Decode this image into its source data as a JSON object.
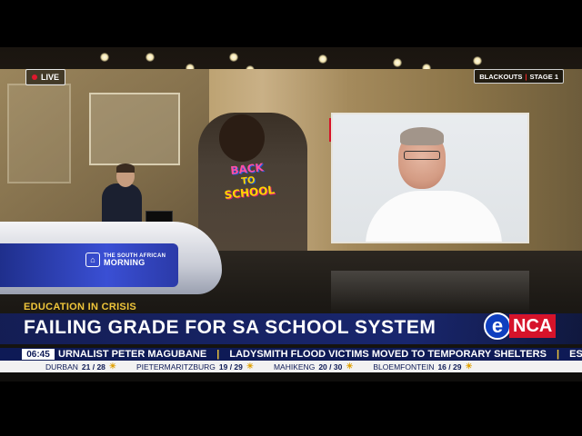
{
  "live_badge": "LIVE",
  "blackout_badge": {
    "label": "BLACKOUTS",
    "separator": "|",
    "stage": "STAGE 1"
  },
  "show_logo": {
    "line1": "THE SOUTH AFRICAN",
    "line2": "MORNING"
  },
  "shirt_text": {
    "line1": "BACK",
    "line2": "TO",
    "line3": "SCHOOL"
  },
  "lower_third": {
    "topic": "EDUCATION IN CRISIS",
    "headline": "FAILING GRADE FOR SA SCHOOL SYSTEM"
  },
  "channel_logo": {
    "e": "e",
    "nca": "NCA"
  },
  "ticker": {
    "time": "06:45",
    "items": [
      "URNALIST PETER MAGUBANE",
      "LADYSMITH FLOOD VICTIMS MOVED TO TEMPORARY SHELTERS",
      "ESKOM I"
    ]
  },
  "weather": [
    {
      "city": "DURBAN",
      "temps": "21 / 28",
      "icon": "partly-sunny-icon"
    },
    {
      "city": "PIETERMARITZBURG",
      "temps": "19 / 29",
      "icon": "partly-sunny-icon"
    },
    {
      "city": "MAHIKENG",
      "temps": "20 / 30",
      "icon": "partly-sunny-icon"
    },
    {
      "city": "BLOEMFONTEIN",
      "temps": "16 / 29",
      "icon": "partly-sunny-icon"
    }
  ],
  "colors": {
    "accent_red": "#d6132a",
    "brand_blue": "#0e1a56",
    "topic_gold": "#f0c63a"
  }
}
